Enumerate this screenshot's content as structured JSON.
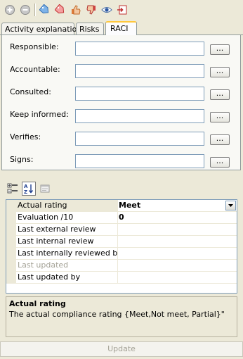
{
  "toolbar": {
    "icons": [
      "add-circle-icon",
      "remove-circle-icon",
      "tag-blue-icon",
      "tag-red-icon",
      "thumbs-up-icon",
      "thumbs-down-icon",
      "eye-icon",
      "export-icon"
    ]
  },
  "tabs": [
    {
      "label": "Activity explanation"
    },
    {
      "label": "Risks"
    },
    {
      "label": "RACI"
    }
  ],
  "raci": {
    "fields": [
      {
        "label": "Responsible:",
        "value": "",
        "button": "..."
      },
      {
        "label": "Accountable:",
        "value": "",
        "button": "..."
      },
      {
        "label": "Consulted:",
        "value": "",
        "button": "..."
      },
      {
        "label": "Keep informed:",
        "value": "",
        "button": "..."
      },
      {
        "label": "Verifies:",
        "value": "",
        "button": "..."
      },
      {
        "label": "Signs:",
        "value": "",
        "button": "..."
      }
    ]
  },
  "property_grid": {
    "sort_buttons": [
      "categorized-icon",
      "alphabetical-icon",
      "property-pages-icon"
    ],
    "rows": [
      {
        "name": "Actual rating",
        "value": "Meet"
      },
      {
        "name": "Evaluation /10",
        "value": "0"
      },
      {
        "name": "Last external review",
        "value": ""
      },
      {
        "name": "Last internal review",
        "value": ""
      },
      {
        "name": "Last internally reviewed by",
        "value": ""
      },
      {
        "name": "Last updated",
        "value": ""
      },
      {
        "name": "Last updated by",
        "value": ""
      }
    ]
  },
  "help": {
    "title": "Actual rating",
    "description": "The actual compliance rating {Meet,Not meet, Partial}\""
  },
  "update_label": "Update"
}
